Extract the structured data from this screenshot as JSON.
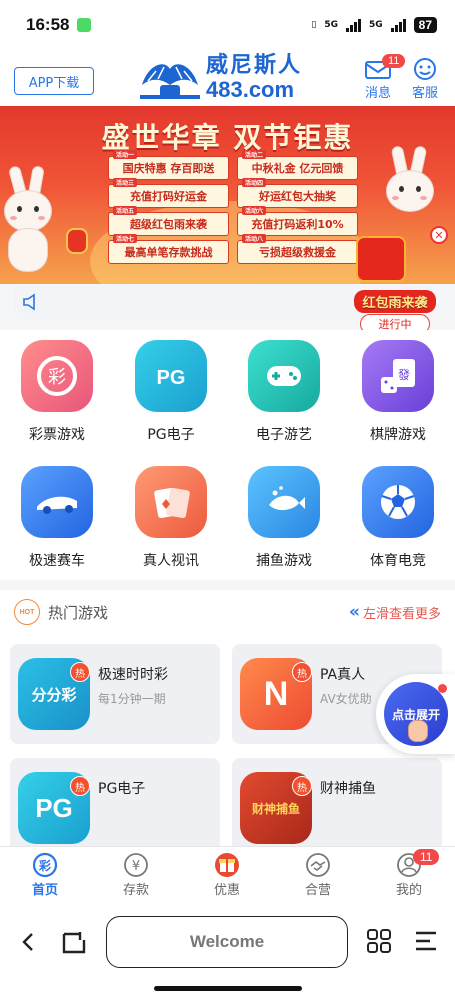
{
  "status_bar": {
    "time": "16:58",
    "network_1": "5G",
    "network_2": "5G",
    "battery": "87"
  },
  "header": {
    "app_download": "APP下载",
    "logo_cn": "威尼斯人",
    "logo_domain": "483.com",
    "messages_label": "消息",
    "messages_badge": "11",
    "service_label": "客服"
  },
  "banner": {
    "title": "盛世华章 双节钜惠",
    "activities": [
      {
        "tag": "活动一",
        "label": "国庆特惠 存百即送"
      },
      {
        "tag": "活动二",
        "label": "中秋礼金 亿元回馈"
      },
      {
        "tag": "活动三",
        "label": "充值打码好运金"
      },
      {
        "tag": "活动四",
        "label": "好运红包大抽奖"
      },
      {
        "tag": "活动五",
        "label": "超级红包雨来袭"
      },
      {
        "tag": "活动六",
        "label": "充值打码返利10%"
      },
      {
        "tag": "活动七",
        "label": "最高单笔存款挑战"
      },
      {
        "tag": "活动八",
        "label": "亏损超级救援金"
      }
    ]
  },
  "red_rain": {
    "title": "红包雨来袭",
    "status": "进行中"
  },
  "categories": [
    {
      "label": "彩票游戏",
      "icon": "lottery-icon",
      "color": "#f26b7a"
    },
    {
      "label": "PG电子",
      "icon": "pg-icon",
      "color": "#21b7d6"
    },
    {
      "label": "电子游艺",
      "icon": "gamepad-icon",
      "color": "#22c2b2"
    },
    {
      "label": "棋牌游戏",
      "icon": "mahjong-icon",
      "color": "#8a5ae8"
    },
    {
      "label": "极速赛车",
      "icon": "racecar-icon",
      "color": "#3c7ff0"
    },
    {
      "label": "真人视讯",
      "icon": "cards-icon",
      "color": "#f37a5a"
    },
    {
      "label": "捕鱼游戏",
      "icon": "fish-icon",
      "color": "#3aa7ef"
    },
    {
      "label": "体育电竞",
      "icon": "soccer-icon",
      "color": "#3c7ff0"
    }
  ],
  "hot_games": {
    "badge": "HOT",
    "title": "热门游戏",
    "more": "左滑查看更多",
    "tag": "热",
    "items": [
      {
        "name": "极速时时彩",
        "desc": "每1分钟一期",
        "icon_text": "分分彩",
        "color": "#24a8d4"
      },
      {
        "name": "PA真人",
        "desc": "AV女优助",
        "icon_text": "N",
        "color": "#f2683b"
      },
      {
        "name": "PG电子",
        "desc": "",
        "icon_text": "PG",
        "color": "#21b7d6"
      },
      {
        "name": "财神捕鱼",
        "desc": "",
        "icon_text": "财神捕鱼",
        "color": "#c2341f"
      }
    ]
  },
  "float_button": {
    "label": "点击展开"
  },
  "tabbar": {
    "items": [
      {
        "label": "首页",
        "icon": "home-lottery-icon",
        "active": true
      },
      {
        "label": "存款",
        "icon": "deposit-icon",
        "active": false
      },
      {
        "label": "优惠",
        "icon": "gift-icon",
        "active": false
      },
      {
        "label": "合营",
        "icon": "handshake-icon",
        "active": false
      },
      {
        "label": "我的",
        "icon": "profile-icon",
        "active": false,
        "badge": "11"
      }
    ]
  },
  "browser": {
    "url_text": "Welcome"
  },
  "colors": {
    "primary": "#2a76e8",
    "badge_red": "#f24848",
    "banner_red": "#e3382d"
  }
}
